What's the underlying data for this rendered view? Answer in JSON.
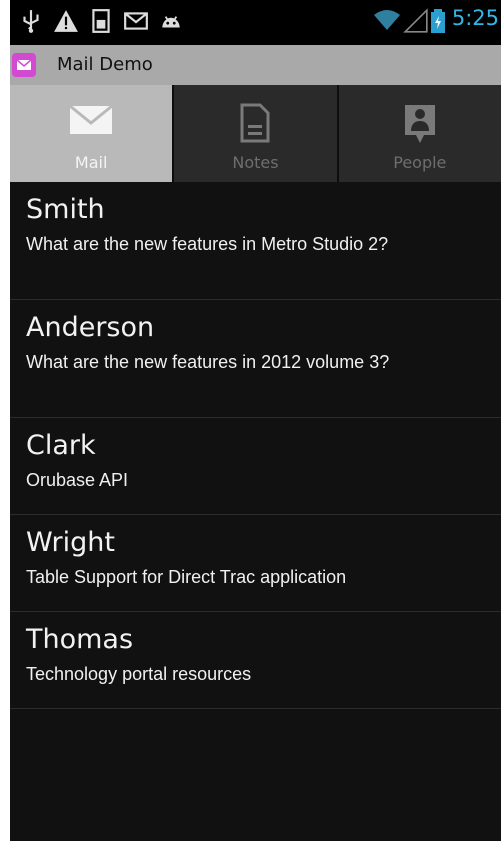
{
  "status_bar": {
    "icons": [
      "usb-icon",
      "warning-icon",
      "sd-card-icon",
      "gmail-icon",
      "android-icon",
      "wifi-icon",
      "signal-icon",
      "battery-icon"
    ],
    "time": "5:25"
  },
  "app": {
    "title": "Mail Demo"
  },
  "tabs": [
    {
      "label": "Mail",
      "icon": "mail-icon",
      "selected": true
    },
    {
      "label": "Notes",
      "icon": "note-icon",
      "selected": false
    },
    {
      "label": "People",
      "icon": "contact-icon",
      "selected": false
    }
  ],
  "mails": [
    {
      "name": "Smith",
      "subject": "What are the new features in Metro Studio 2?"
    },
    {
      "name": "Anderson",
      "subject": "What are the new features in 2012 volume 3?"
    },
    {
      "name": "Clark",
      "subject": "Orubase API"
    },
    {
      "name": "Wright",
      "subject": "Table Support for Direct Trac application"
    },
    {
      "name": "Thomas",
      "subject": "Technology portal resources"
    }
  ],
  "colors": {
    "accent": "#31b6e7",
    "app_icon": "#d24ad2",
    "active_tab": "#b9b9b9"
  }
}
